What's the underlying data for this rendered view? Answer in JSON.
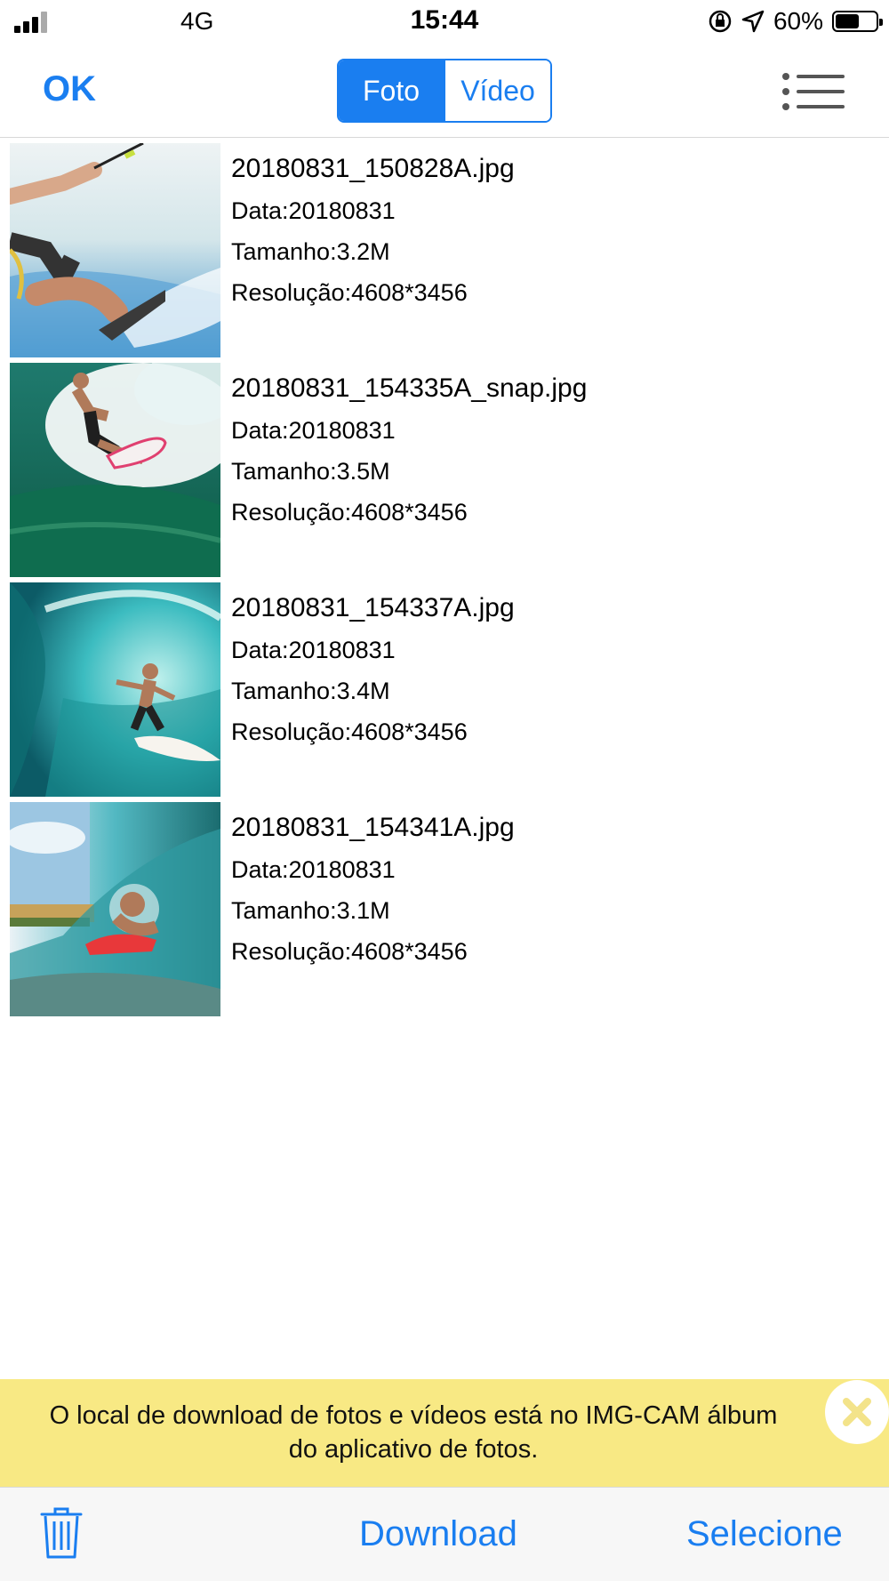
{
  "status_bar": {
    "network": "4G",
    "time": "15:44",
    "battery": "60%",
    "battery_level": 0.6
  },
  "nav": {
    "ok_label": "OK",
    "segments": [
      "Foto",
      "Vídeo"
    ],
    "selected_segment": "Foto",
    "menu_icon": "list-menu-icon"
  },
  "files": [
    {
      "name": "20180831_150828A.jpg",
      "date": "Data:20180831",
      "size": "Tamanho:3.2M",
      "resolution": "Resolução:4608*3456"
    },
    {
      "name": "20180831_154335A_snap.jpg",
      "date": "Data:20180831",
      "size": "Tamanho:3.5M",
      "resolution": "Resolução:4608*3456"
    },
    {
      "name": "20180831_154337A.jpg",
      "date": "Data:20180831",
      "size": "Tamanho:3.4M",
      "resolution": "Resolução:4608*3456"
    },
    {
      "name": "20180831_154341A.jpg",
      "date": "Data:20180831",
      "size": "Tamanho:3.1M",
      "resolution": "Resolução:4608*3456"
    }
  ],
  "banner": {
    "line1": "O local de download de fotos e vídeos está no IMG-CAM álbum",
    "line2": "do aplicativo de fotos.",
    "close_icon": "close-icon",
    "color": "#f8e984"
  },
  "toolbar": {
    "trash_icon": "trash-icon",
    "download_label": "Download",
    "select_label": "Selecione"
  },
  "colors": {
    "accent": "#1a7ef0"
  }
}
